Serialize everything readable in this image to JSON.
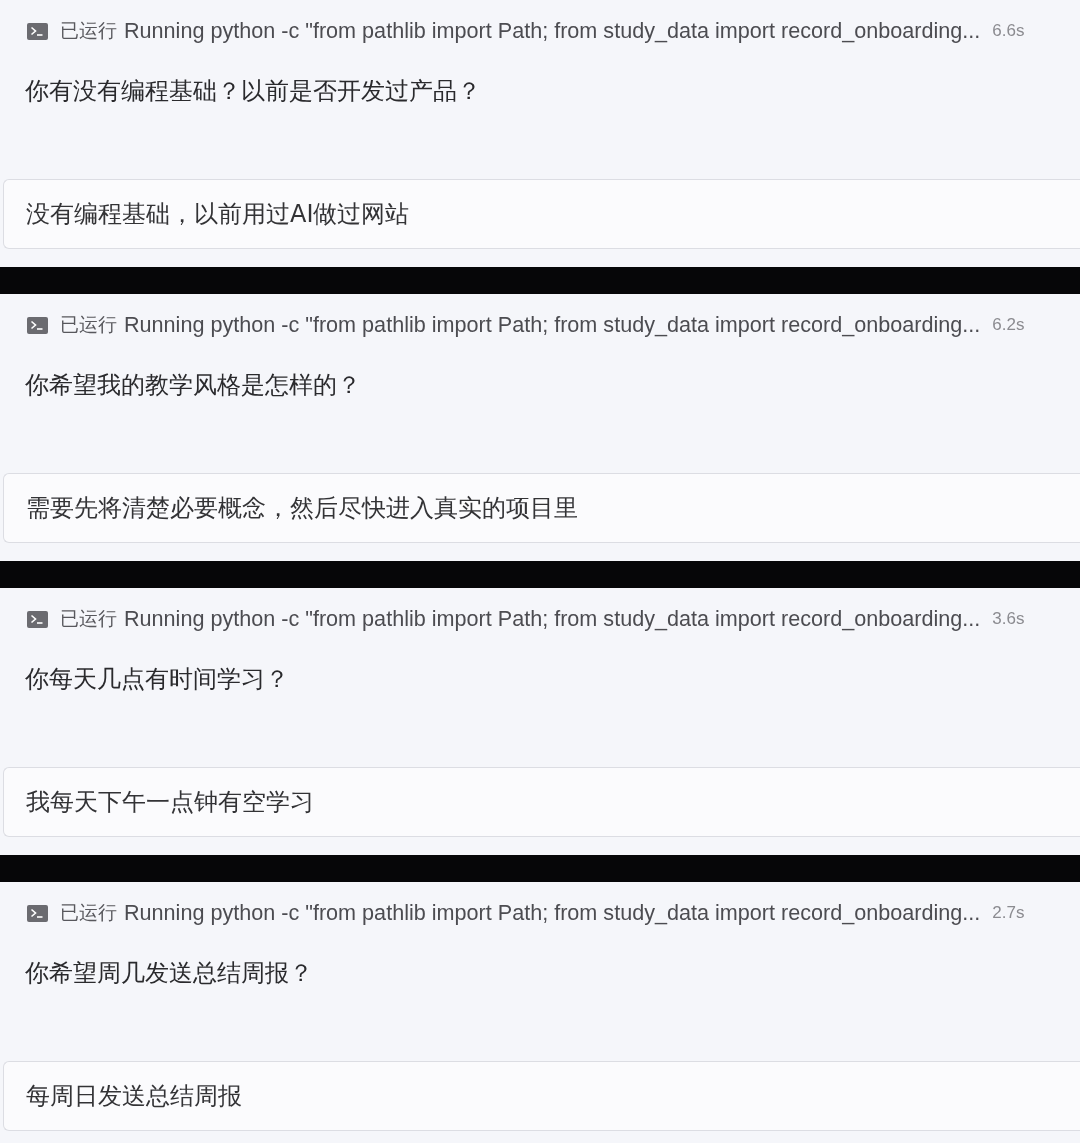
{
  "steps": [
    {
      "tool_call": {
        "status": "已运行",
        "command": "Running python -c \"from pathlib import Path; from study_data import record_onboarding...",
        "duration": "6.6s"
      },
      "question": "你有没有编程基础？以前是否开发过产品？",
      "answer": "没有编程基础，以前用过AI做过网站"
    },
    {
      "tool_call": {
        "status": "已运行",
        "command": "Running python -c \"from pathlib import Path; from study_data import record_onboarding...",
        "duration": "6.2s"
      },
      "question": "你希望我的教学风格是怎样的？",
      "answer": "需要先将清楚必要概念，然后尽快进入真实的项目里"
    },
    {
      "tool_call": {
        "status": "已运行",
        "command": "Running python -c \"from pathlib import Path; from study_data import record_onboarding...",
        "duration": "3.6s"
      },
      "question": "你每天几点有时间学习？",
      "answer": "我每天下午一点钟有空学习"
    },
    {
      "tool_call": {
        "status": "已运行",
        "command": "Running python -c \"from pathlib import Path; from study_data import record_onboarding...",
        "duration": "2.7s"
      },
      "question": "你希望周几发送总结周报？",
      "answer": "每周日发送总结周报"
    }
  ]
}
